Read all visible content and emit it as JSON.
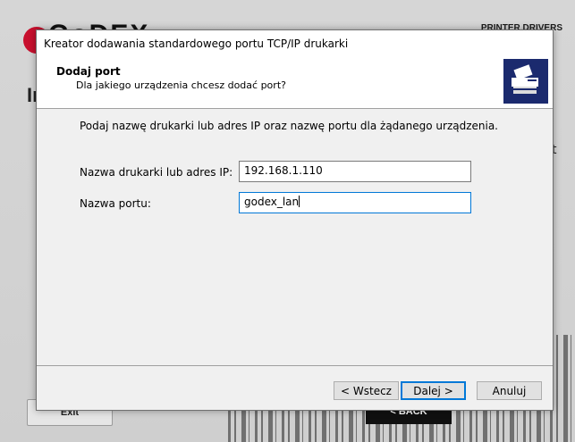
{
  "background": {
    "logo_text": "GoDEX",
    "header_right_text": "PRINTER DRIVERS",
    "heading_text": "In",
    "side_glyph": "t",
    "exit_label": "Exit",
    "back_label": "< BACK"
  },
  "dialog": {
    "title": "Kreator dodawania standardowego portu TCP/IP drukarki",
    "header": {
      "title": "Dodaj port",
      "subtitle": "Dla jakiego urządzenia chcesz dodać port?",
      "icon": "printer-network-icon"
    },
    "instruction": "Podaj nazwę drukarki lub adres IP oraz nazwę portu dla żądanego urządzenia.",
    "fields": {
      "address_label": "Nazwa drukarki lub adres IP:",
      "address_value": "192.168.1.110",
      "port_label": "Nazwa portu:",
      "port_value": "godex_lan"
    },
    "buttons": {
      "back": "< Wstecz",
      "next": "Dalej >",
      "cancel": "Anuluj"
    }
  },
  "colors": {
    "brand_red": "#c8102e",
    "focus_blue": "#0078d7",
    "icon_bg": "#1b2a6e"
  }
}
